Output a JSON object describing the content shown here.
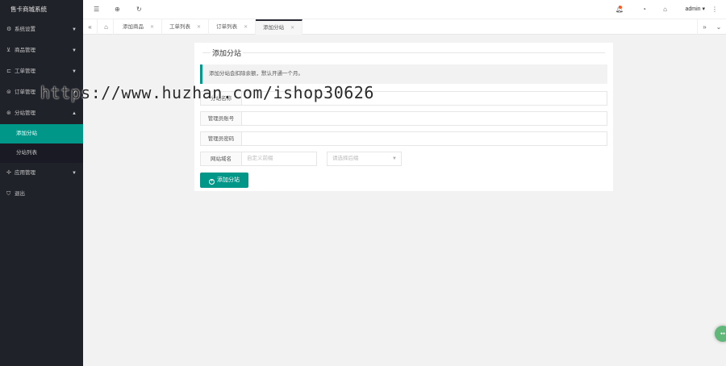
{
  "app": {
    "title": "售卡商城系统"
  },
  "sidebar": {
    "items": [
      {
        "label": "系统设置",
        "icon": "gear-icon"
      },
      {
        "label": "商品管理",
        "icon": "cart-icon"
      },
      {
        "label": "工单管理",
        "icon": "ticket-icon"
      },
      {
        "label": "订单管理",
        "icon": "order-icon"
      },
      {
        "label": "分站管理",
        "icon": "site-icon",
        "sub": [
          "添加分站",
          "分站列表"
        ]
      },
      {
        "label": "应用管理",
        "icon": "app-icon"
      },
      {
        "label": "退出",
        "icon": "logout-icon"
      }
    ]
  },
  "topbar": {
    "user": "admin",
    "notify_color": "#ff5722"
  },
  "tabs": [
    "添加商品",
    "工单列表",
    "订单列表",
    "添加分站"
  ],
  "page": {
    "title": "添加分站",
    "notice": "添加分站会扣除余额，默认开通一个月。",
    "fields": [
      {
        "label": "分站名称",
        "placeholder": ""
      },
      {
        "label": "管理员账号",
        "placeholder": ""
      },
      {
        "label": "管理员密码",
        "placeholder": ""
      }
    ],
    "domain": {
      "label": "网站域名",
      "placeholder": "自定义前缀",
      "select_placeholder": "请选择后缀"
    },
    "submit": "添加分站"
  },
  "watermark": "https://www.huzhan.com/ishop30626",
  "colors": {
    "accent": "#009688",
    "sidebar_bg": "#20222a"
  }
}
